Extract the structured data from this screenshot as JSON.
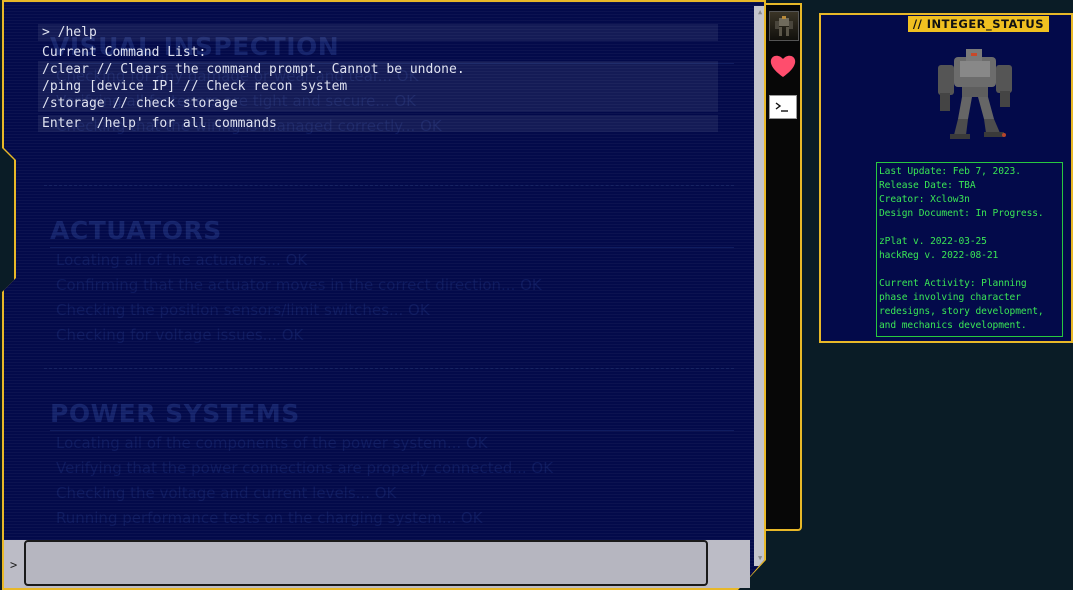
{
  "terminal": {
    "background": {
      "sections": [
        {
          "heading": "VISUAL INSPECTION",
          "lines": [
            "Checking for any damage or wear and tear... OK",
            "Verifying all fasteners are tight and secure... OK",
            "Checking that the wiring is managed correctly... OK"
          ]
        },
        {
          "heading": "ACTUATORS",
          "lines": [
            "Locating all of the actuators... OK",
            "Confirming that the actuator moves in the correct direction... OK",
            "Checking the position sensors/limit switches... OK",
            "Checking for voltage issues... OK"
          ]
        },
        {
          "heading": "POWER SYSTEMS",
          "lines": [
            "Locating all of the components of the power system... OK",
            "Verifying that the power connections are properly connected... OK",
            "Checking the voltage and current levels... OK",
            "Running performance tests on the charging system... OK"
          ]
        }
      ]
    },
    "output": {
      "command_echo": "> /help",
      "list_header": "Current Command List:",
      "commands": [
        "/clear // Clears the command prompt. Cannot be undone.",
        "/ping [device IP] // Check recon system",
        "/storage // check storage"
      ],
      "hint": "Enter '/help' for all commands"
    },
    "input": {
      "prompt": ">",
      "value": "",
      "placeholder": ""
    }
  },
  "sidebar": {
    "buttons": [
      {
        "icon": "mech-avatar-icon"
      },
      {
        "icon": "heart-icon",
        "color": "#ff4d6d"
      },
      {
        "icon": "terminal-icon"
      }
    ]
  },
  "status_card": {
    "title": "// INTEGER_STATUS",
    "info_lines": [
      "Last Update: Feb 7, 2023.",
      "Release Date: TBA",
      "Creator: Xclow3n",
      "Design Document: In Progress."
    ],
    "version_lines": [
      "zPlat v. 2022-03-25",
      "hackReg v. 2022-08-21"
    ],
    "activity_lines": [
      "Current Activity: Planning",
      "phase involving character",
      "redesigns, story development,",
      "and mechanics development."
    ]
  },
  "colors": {
    "accent": "#e8b828",
    "terminal_bg": "#030a4a",
    "status_text": "#3ae655",
    "page_bg": "#0a1c26"
  }
}
